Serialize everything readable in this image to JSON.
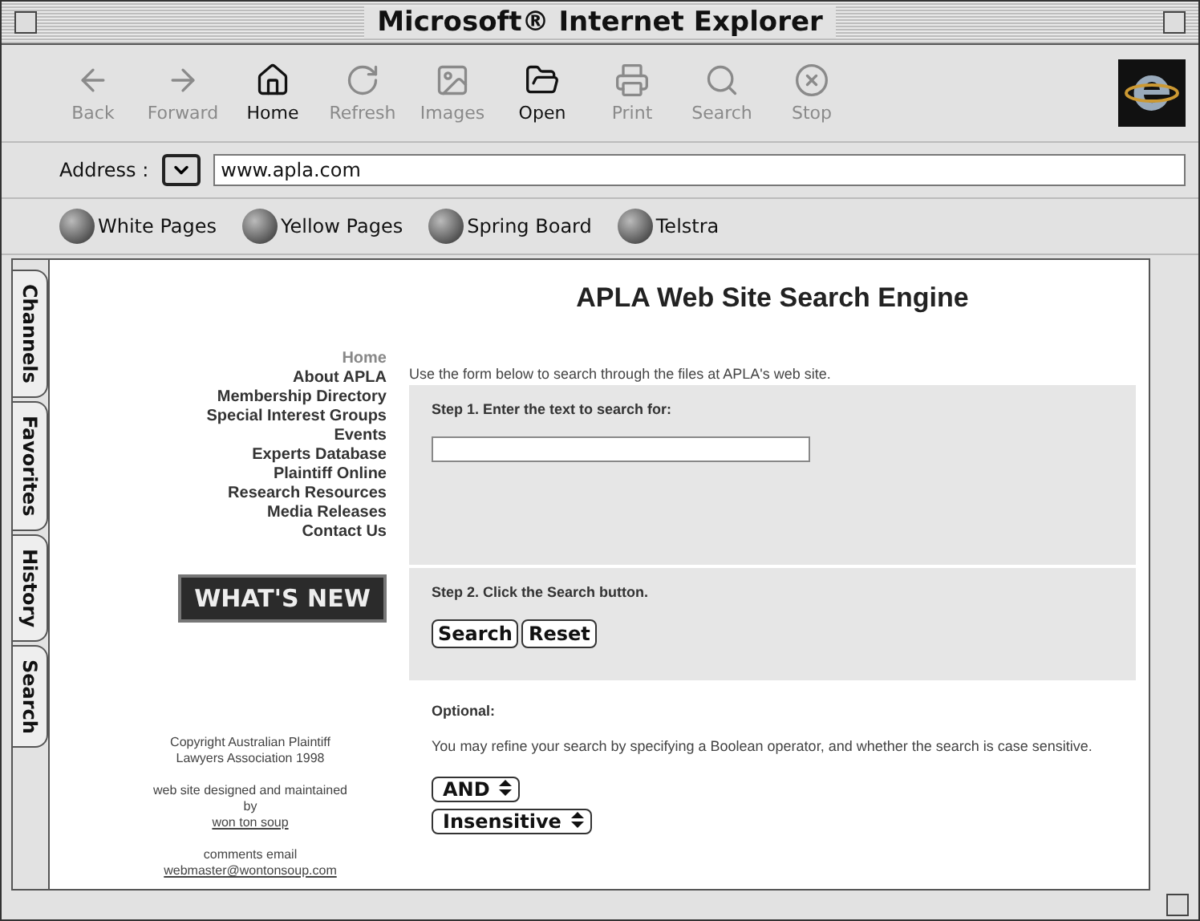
{
  "window": {
    "title": "Microsoft® Internet Explorer"
  },
  "toolbar": [
    {
      "label": "Back",
      "disabled": true
    },
    {
      "label": "Forward",
      "disabled": true
    },
    {
      "label": "Home",
      "disabled": false
    },
    {
      "label": "Refresh",
      "disabled": true
    },
    {
      "label": "Images",
      "disabled": true
    },
    {
      "label": "Open",
      "disabled": false
    },
    {
      "label": "Print",
      "disabled": true
    },
    {
      "label": "Search",
      "disabled": true
    },
    {
      "label": "Stop",
      "disabled": true
    }
  ],
  "address": {
    "label": "Address :",
    "value": "www.apla.com"
  },
  "favorites": [
    "White Pages",
    "Yellow Pages",
    "Spring Board",
    "Telstra"
  ],
  "side_tabs": [
    "Channels",
    "Favorites",
    "History",
    "Search"
  ],
  "nav": [
    {
      "label": "Home",
      "selected": true
    },
    {
      "label": "About APLA",
      "selected": false
    },
    {
      "label": "Membership Directory",
      "selected": false
    },
    {
      "label": "Special Interest Groups",
      "selected": false
    },
    {
      "label": "Events",
      "selected": false
    },
    {
      "label": "Experts Database",
      "selected": false
    },
    {
      "label": "Plaintiff Online",
      "selected": false
    },
    {
      "label": "Research Resources",
      "selected": false
    },
    {
      "label": "Media Releases",
      "selected": false
    },
    {
      "label": "Contact Us",
      "selected": false
    }
  ],
  "whats_new": "WHAT'S NEW",
  "copyright": [
    "Copyright  Australian Plaintiff",
    "Lawyers Association 1998"
  ],
  "credit": {
    "text": "web site designed and maintained",
    "by": "by",
    "link": "won ton soup"
  },
  "contact": {
    "text": "comments email",
    "link": "webmaster@wontonsoup.com"
  },
  "page": {
    "title": "APLA Web Site Search Engine",
    "intro": "Use the form below to search through the files at APLA's web site.",
    "step1": "Step 1. Enter the text to search for:",
    "step2": "Step 2. Click the Search button.",
    "buttons": [
      "Search",
      "Reset"
    ],
    "optional": "Optional:",
    "refine": "You may refine your search by specifying a Boolean operator, and whether the search is case sensitive.",
    "selects": [
      "AND",
      "Insensitive"
    ]
  }
}
